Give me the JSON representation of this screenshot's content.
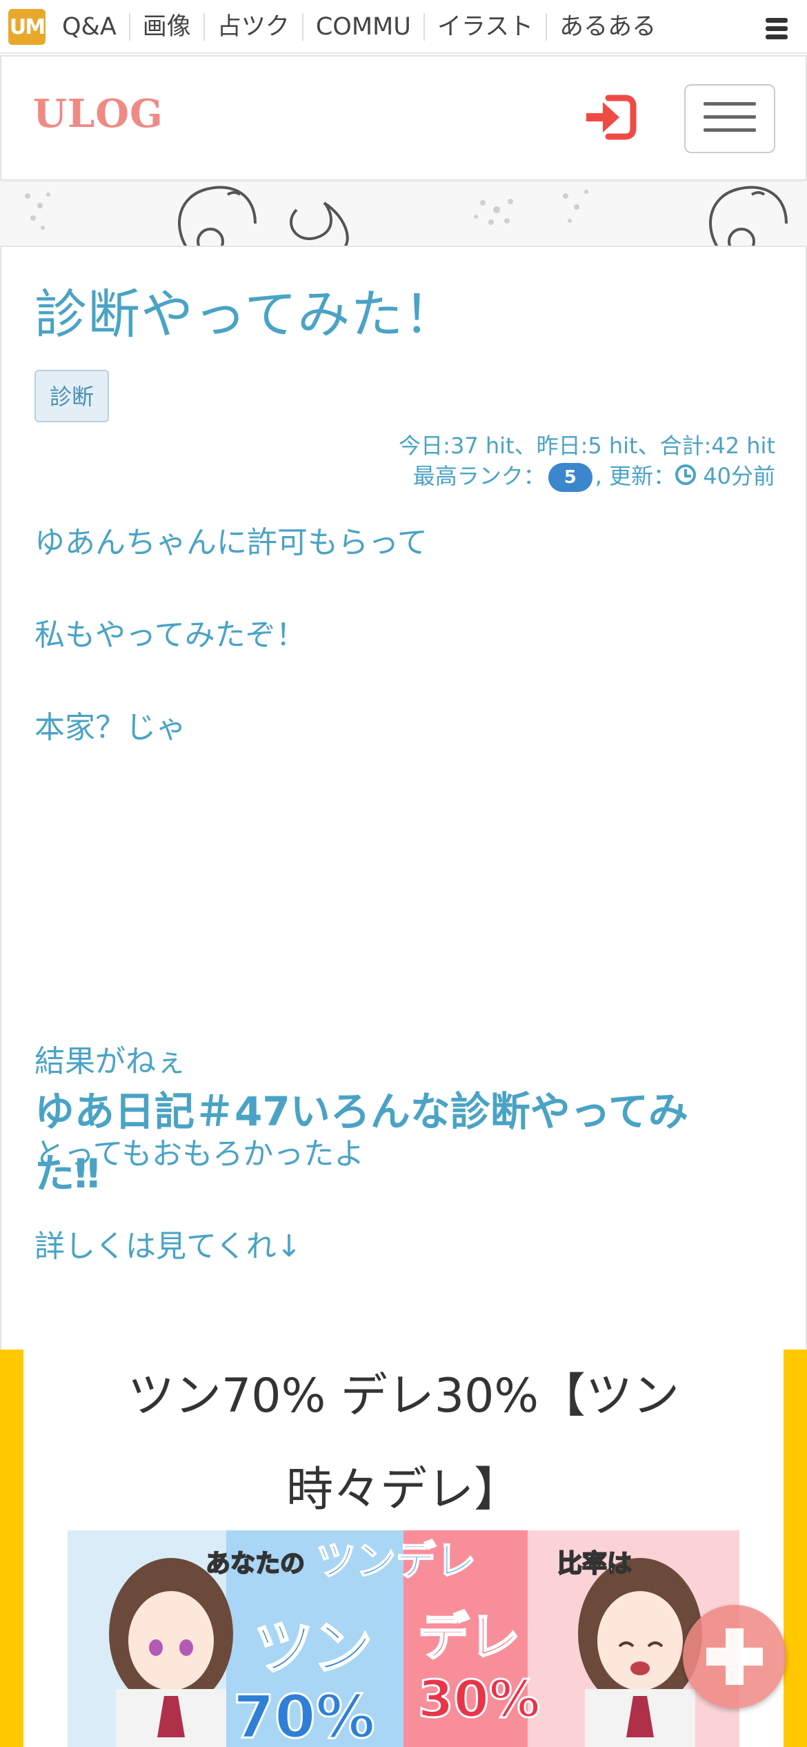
{
  "site_bar": {
    "logo_text": "UM",
    "nav": [
      "Q&A",
      "画像",
      "占ツク",
      "COMMU",
      "イラスト",
      "あるある"
    ]
  },
  "header": {
    "brand": "ULOG"
  },
  "post": {
    "title": "診断やってみた！",
    "tag": "診断",
    "stats_line1": "今日:37 hit、昨日:5 hit、合計:42 hit",
    "rank_label": "最高ランク：",
    "rank_value": "5",
    "updated_label": ", 更新：",
    "updated_value": "40分前",
    "paragraphs": [
      "ゆあんちゃんに許可もらって",
      "私もやってみたぞ！",
      "本家？じゃ"
    ],
    "subheading": "ゆあ日記＃47いろんな診断やってみた‼",
    "paragraphs2": [
      "結果がねぇ",
      "とってもおもろかったよ",
      "詳しくは見てくれ↓"
    ]
  },
  "result": {
    "title": "ツン70% デレ30%【ツン時々デレ】",
    "image_text": {
      "header_a": "あなたの",
      "header_b": "ツンデレ",
      "header_c": "比率は",
      "left_word": "ツン",
      "left_pct": "70%",
      "right_word": "デレ",
      "right_pct": "30%"
    }
  },
  "colors": {
    "accent_blue": "#4aa3c5",
    "brand_pink": "#f08a84",
    "logo_orange": "#e9a82b",
    "badge_blue": "#3b86cc",
    "embed_yellow": "#ffc800"
  }
}
